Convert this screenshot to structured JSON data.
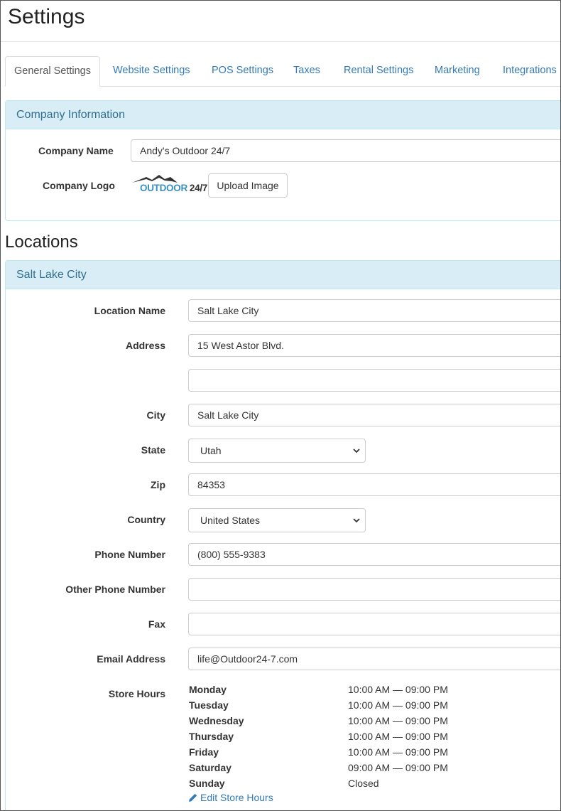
{
  "page_title": "Settings",
  "tabs": [
    {
      "label": "General Settings",
      "active": true
    },
    {
      "label": "Website Settings"
    },
    {
      "label": "POS Settings"
    },
    {
      "label": "Taxes"
    },
    {
      "label": "Rental Settings"
    },
    {
      "label": "Marketing"
    },
    {
      "label": "Integrations"
    }
  ],
  "company": {
    "heading": "Company Information",
    "name_label": "Company Name",
    "name_value": "Andy's Outdoor 24/7",
    "logo_label": "Company Logo",
    "logo_text_a": "OUTDOOR",
    "logo_text_b": "24/7",
    "upload_label": "Upload Image"
  },
  "locations": {
    "title": "Locations",
    "location_heading": "Salt Lake City",
    "fields": {
      "location_name": {
        "label": "Location Name",
        "value": "Salt Lake City"
      },
      "address": {
        "label": "Address",
        "value": "15 West Astor Blvd.",
        "value2": ""
      },
      "city": {
        "label": "City",
        "value": "Salt Lake City"
      },
      "state": {
        "label": "State",
        "value": "Utah"
      },
      "zip": {
        "label": "Zip",
        "value": "84353"
      },
      "country": {
        "label": "Country",
        "value": "United States"
      },
      "phone": {
        "label": "Phone Number",
        "value": "(800) 555-9383"
      },
      "other_phone": {
        "label": "Other Phone Number",
        "value": ""
      },
      "fax": {
        "label": "Fax",
        "value": ""
      },
      "email": {
        "label": "Email Address",
        "value": "life@Outdoor24-7.com"
      }
    },
    "store_hours": {
      "label": "Store Hours",
      "days": [
        {
          "day": "Monday",
          "hours": "10:00 AM — 09:00 PM"
        },
        {
          "day": "Tuesday",
          "hours": "10:00 AM — 09:00 PM"
        },
        {
          "day": "Wednesday",
          "hours": "10:00 AM — 09:00 PM"
        },
        {
          "day": "Thursday",
          "hours": "10:00 AM — 09:00 PM"
        },
        {
          "day": "Friday",
          "hours": "10:00 AM — 09:00 PM"
        },
        {
          "day": "Saturday",
          "hours": "09:00 AM — 09:00 PM"
        },
        {
          "day": "Sunday",
          "hours": "Closed"
        }
      ],
      "edit_label": "Edit Store Hours"
    }
  },
  "colors": {
    "link": "#337ab7",
    "panel_heading_bg": "#d9edf7",
    "panel_heading_text": "#31708f",
    "panel_border": "#bce8f1"
  },
  "icons": {
    "dropdown": "chevron-down-icon",
    "edit": "pencil-icon",
    "logo": "mountain-logo-icon"
  }
}
